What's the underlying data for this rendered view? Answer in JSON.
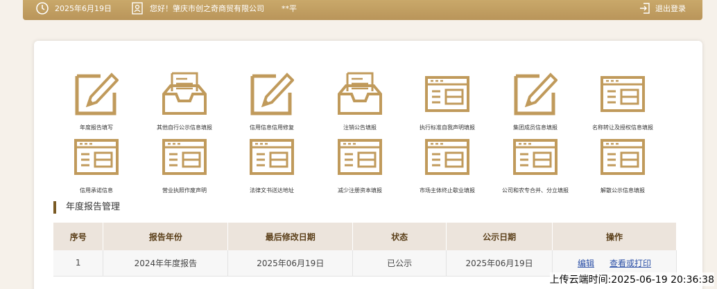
{
  "topbar": {
    "date": "2025年6月19日",
    "greeting": "您好！肇庆市创之奇商贸有限公司",
    "user": "**平",
    "logout": "退出登录"
  },
  "tiles": [
    {
      "label": "年度报告填写",
      "icon": "edit-icon"
    },
    {
      "label": "其他自行公示信息填报",
      "icon": "inbox-document-icon"
    },
    {
      "label": "信用信息信用修复",
      "icon": "edit-icon"
    },
    {
      "label": "注销公告填报",
      "icon": "inbox-document-icon"
    },
    {
      "label": "执行标准自我声明填报",
      "icon": "form-window-icon"
    },
    {
      "label": "集团成员信息填报",
      "icon": "edit-icon"
    },
    {
      "label": "名称转让及授权信息填报",
      "icon": "form-window-icon"
    },
    {
      "label": "信用承诺信息",
      "icon": "form-window-icon"
    },
    {
      "label": "营业执照作废声明",
      "icon": "form-window-icon"
    },
    {
      "label": "法律文书送达地址",
      "icon": "form-window-icon"
    },
    {
      "label": "减少注册资本填报",
      "icon": "form-window-icon"
    },
    {
      "label": "市场主体终止歇业填报",
      "icon": "form-window-icon"
    },
    {
      "label": "公司和农专合并、分立填报",
      "icon": "form-window-icon"
    },
    {
      "label": "解散公示信息填报",
      "icon": "form-window-icon"
    }
  ],
  "section": {
    "title": "年度报告管理"
  },
  "table": {
    "headers": [
      "序号",
      "报告年份",
      "最后修改日期",
      "状态",
      "公示日期",
      "操作"
    ],
    "rows": [
      {
        "no": "1",
        "year": "2024年年度报告",
        "modified": "2025年06月19日",
        "status": "已公示",
        "published": "2025年06月19日",
        "edit": "编辑",
        "view": "查看或打印"
      }
    ]
  },
  "stamp": "上传云端时间:2025-06-19 20:36:38",
  "colors": {
    "gold": "#c09a5b",
    "dark_gold": "#7a5a24",
    "link": "#2a4fa6"
  }
}
